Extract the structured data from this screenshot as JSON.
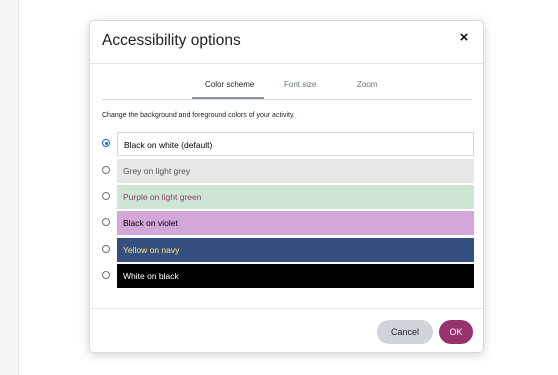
{
  "dialog": {
    "title": "Accessibility options",
    "close_glyph": "×",
    "close_icon": "close-icon"
  },
  "tabs": [
    {
      "label": "Color scheme",
      "active": true
    },
    {
      "label": "Font size",
      "active": false
    },
    {
      "label": "Zoom",
      "active": false
    }
  ],
  "description": "Change the background and foreground colors of your activity.",
  "options": [
    {
      "label": "Black on white (default)",
      "selected": true,
      "bg": "#ffffff",
      "fg": "#000000",
      "border": "#d6d6d6"
    },
    {
      "label": "Grey on light grey",
      "selected": false,
      "bg": "#e8e6e6",
      "fg": "#555555"
    },
    {
      "label": "Purple on light green",
      "selected": false,
      "bg": "#cfe6d4",
      "fg": "#8a3f6e"
    },
    {
      "label": "Black on violet",
      "selected": false,
      "bg": "#d3a8d9",
      "fg": "#000000"
    },
    {
      "label": "Yellow on navy",
      "selected": false,
      "bg": "#344f80",
      "fg": "#ffe66b"
    },
    {
      "label": "White on black",
      "selected": false,
      "bg": "#000000",
      "fg": "#ffffff"
    }
  ],
  "footer": {
    "cancel_label": "Cancel",
    "ok_label": "OK"
  },
  "colors": {
    "accent": "#0f6cbf",
    "ok_button": "#98326f",
    "cancel_button": "#ced4da"
  }
}
